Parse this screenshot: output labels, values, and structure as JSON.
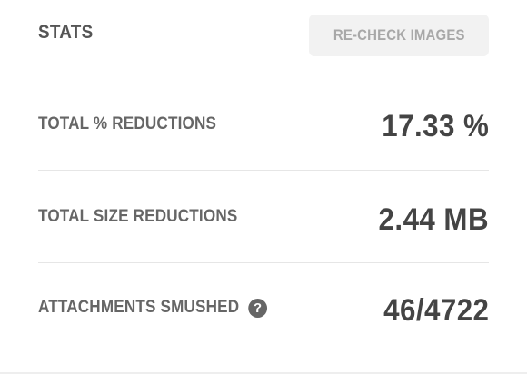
{
  "header": {
    "title": "STATS",
    "recheck_button": "RE-CHECK IMAGES"
  },
  "stats": [
    {
      "label": "TOTAL % REDUCTIONS",
      "value": "17.33 %"
    },
    {
      "label": "TOTAL SIZE REDUCTIONS",
      "value": "2.44 MB"
    },
    {
      "label": "ATTACHMENTS SMUSHED",
      "value": "46/4722",
      "help_icon": "question-circle-icon"
    }
  ],
  "help_glyph": "?"
}
